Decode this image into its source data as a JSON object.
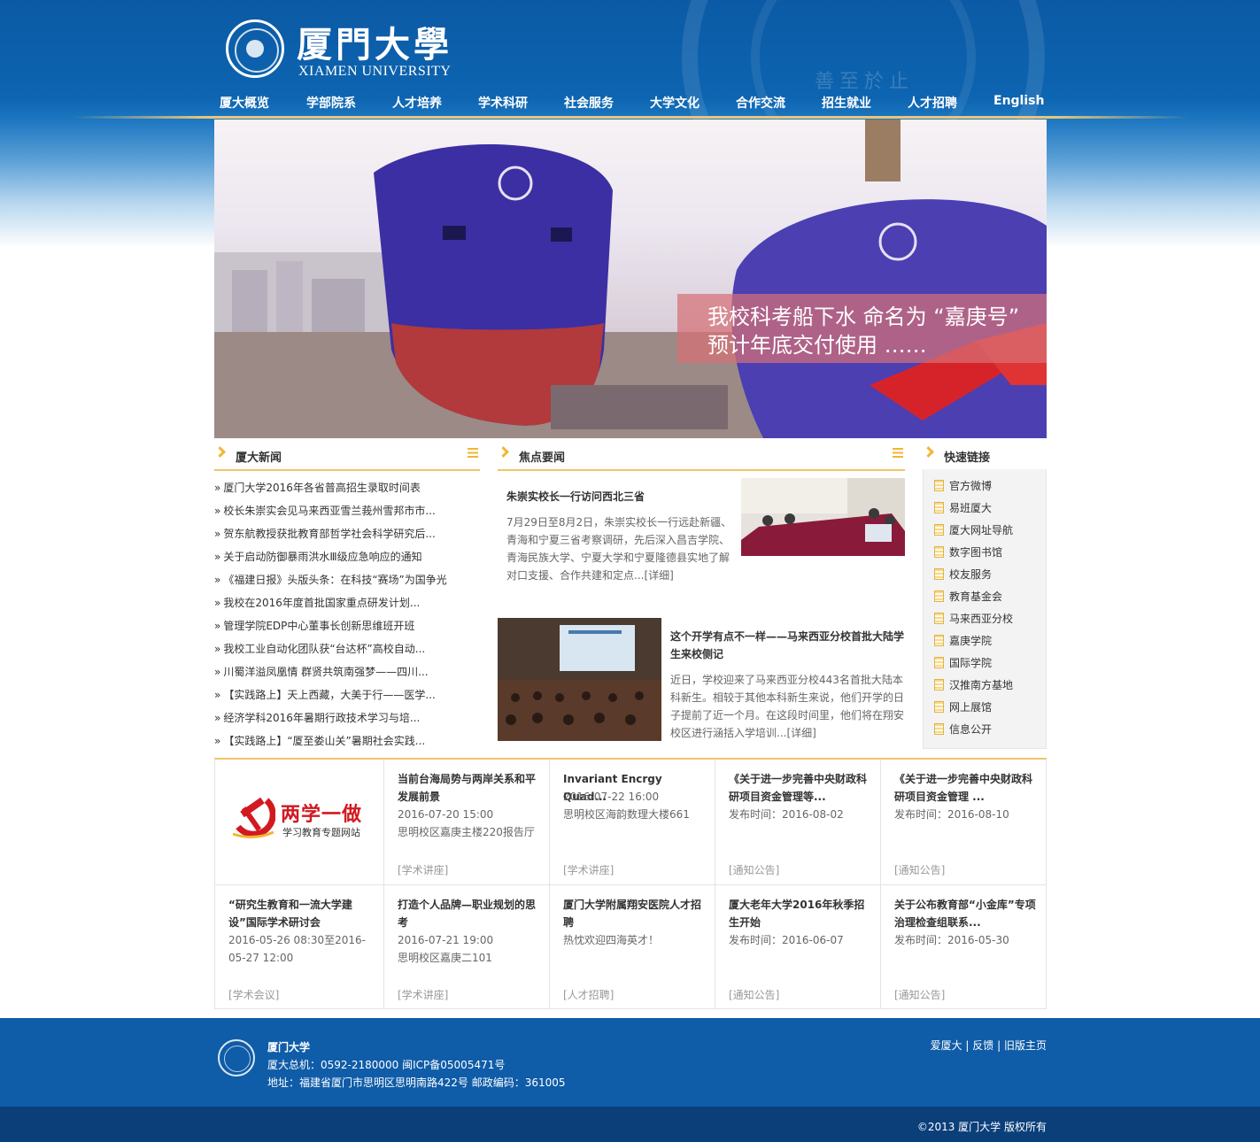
{
  "header": {
    "logo_cn": "厦門大學",
    "logo_en": "XIAMEN UNIVERSITY",
    "seal_motto": "善至於止"
  },
  "nav": {
    "items": [
      "厦大概览",
      "学部院系",
      "人才培养",
      "学术科研",
      "社会服务",
      "大学文化",
      "合作交流",
      "招生就业",
      "人才招聘",
      "English"
    ]
  },
  "banner": {
    "caption_line1": "我校科考船下水 命名为 “嘉庚号”",
    "caption_line2": "预计年底交付使用 ……"
  },
  "news": {
    "title": "厦大新闻",
    "items": [
      "厦门大学2016年各省普高招生录取时间表",
      "校长朱崇实会见马来西亚雪兰莪州雪邦市市...",
      "贺东航教授获批教育部哲学社会科学研究后...",
      "关于启动防御暴雨洪水Ⅲ级应急响应的通知",
      "《福建日报》头版头条：在科技“赛场”为国争光",
      "我校在2016年度首批国家重点研发计划...",
      "管理学院EDP中心董事长创新思维班开班",
      "我校工业自动化团队获“台达杯”高校自动...",
      "川蜀洋溢凤凰情 群贤共筑南强梦——四川...",
      "【实践路上】天上西藏，大美于行——医学...",
      "经济学科2016年暑期行政技术学习与培...",
      "【实践路上】“厦至娄山关”暑期社会实践..."
    ]
  },
  "focus": {
    "title": "焦点要闻",
    "story1": {
      "title": "朱崇实校长一行访问西北三省",
      "text": "7月29日至8月2日，朱崇实校长一行远赴新疆、青海和宁夏三省考察调研，先后深入昌吉学院、青海民族大学、宁夏大学和宁夏隆德县实地了解对口支援、合作共建和定点...",
      "detail": "[详细]"
    },
    "story2": {
      "title": "这个开学有点不一样——马来西亚分校首批大陆学生来校侧记",
      "text": "近日，学校迎来了马来西亚分校443名首批大陆本科新生。相较于其他本科新生来说，他们开学的日子提前了近一个月。在这段时间里，他们将在翔安校区进行涵括入学培训...",
      "detail": "[详细]"
    }
  },
  "quick_links": {
    "title": "快速链接",
    "items": [
      "官方微博",
      "易班厦大",
      "厦大网址导航",
      "数字图书馆",
      "校友服务",
      "教育基金会",
      "马来西亚分校",
      "嘉庚学院",
      "国际学院",
      "汉推南方基地",
      "网上展馆",
      "信息公开"
    ]
  },
  "party_banner": {
    "title": "两学一做",
    "subtitle": "学习教育专题网站"
  },
  "events": [
    {
      "title": "当前台海局势与两岸关系和平发展前景",
      "lines": [
        "2016-07-20 15:00",
        "思明校区嘉庚主楼220报告厅"
      ],
      "tag": "[学术讲座]"
    },
    {
      "title": "Invariant Encrgy Quad...",
      "lines": [
        "2016-07-22 16:00",
        "思明校区海韵数理大楼661"
      ],
      "tag": "[学术讲座]"
    },
    {
      "title": "《关于进一步完善中央财政科研项目资金管理等...",
      "lines": [
        "发布时间：2016-08-02"
      ],
      "tag": "[通知公告]"
    },
    {
      "title": "《关于进一步完善中央财政科研项目资金管理 ...",
      "lines": [
        "发布时间：2016-08-10"
      ],
      "tag": "[通知公告]"
    },
    {
      "title": "“研究生教育和一流大学建设”国际学术研讨会",
      "lines": [
        "2016-05-26 08:30至2016-",
        "05-27 12:00"
      ],
      "tag": "[学术会议]"
    },
    {
      "title": "打造个人品牌—职业规划的思考",
      "lines": [
        "2016-07-21 19:00",
        "思明校区嘉庚二101"
      ],
      "tag": "[学术讲座]"
    },
    {
      "title": "厦门大学附属翔安医院人才招聘",
      "lines": [
        "热忱欢迎四海英才！"
      ],
      "tag": "[人才招聘]"
    },
    {
      "title": "厦大老年大学2016年秋季招生开始",
      "lines": [
        "发布时间：2016-06-07"
      ],
      "tag": "[通知公告]"
    },
    {
      "title": "关于公布教育部“小金库”专项治理检查组联系...",
      "lines": [
        "发布时间：2016-05-30"
      ],
      "tag": "[通知公告]"
    }
  ],
  "footer": {
    "name": "厦门大学",
    "phone": "厦大总机：0592-2180000 闽ICP备05005471号",
    "address": "地址：福建省厦门市思明区思明南路422号 邮政编码：361005",
    "links": [
      "爱厦大",
      "反馈",
      "旧版主页"
    ],
    "copyright": "©2013 厦门大学 版权所有"
  },
  "colors": {
    "brand_blue": "#0b5aa5",
    "accent_gold": "#f2c466",
    "footer_blue": "#0f5ca8",
    "copyright_bar": "#0a3f7a",
    "party_red": "#d21920"
  },
  "icons": {
    "section_marker": "chevron-right-icon",
    "more": "list-icon",
    "quick_link": "document-icon"
  }
}
